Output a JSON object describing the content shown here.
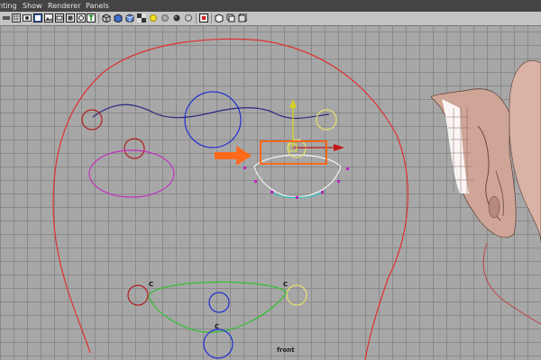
{
  "menu": {
    "items": [
      "nting",
      "Show",
      "Renderer",
      "Panels"
    ]
  },
  "toolbar": {
    "icons": [
      "slider-icon",
      "grid-toggle-icon",
      "camera-icon",
      "film-gate-icon",
      "image-plane-icon",
      "resolution-gate-icon",
      "text-icon",
      "wireframe-icon",
      "smooth-shade-icon",
      "textured-icon",
      "light-icon",
      "shadow-icon",
      "sphere-icon",
      "isolate-icon",
      "xray-icon",
      "xray-joints-icon",
      "cube-icon"
    ]
  },
  "viewport": {
    "camera_label": "front",
    "control_labels": [
      "C",
      "C",
      "C"
    ]
  },
  "colors": {
    "menubar": "#444444",
    "toolbar": "#c4c4c4",
    "viewport_bg": "#a7a7a7",
    "grid": "#8a8a8a",
    "head_curve": "#e03030",
    "mouth_curve": "#30c030",
    "eye_blue": "#2030d0",
    "eyelid_magenta": "#c030c0",
    "yellow_ctrl": "#e6e070",
    "highlight_orange": "#ff6a1a",
    "cyan_curve": "#30c0c0",
    "skin": "#d8b0a0"
  }
}
